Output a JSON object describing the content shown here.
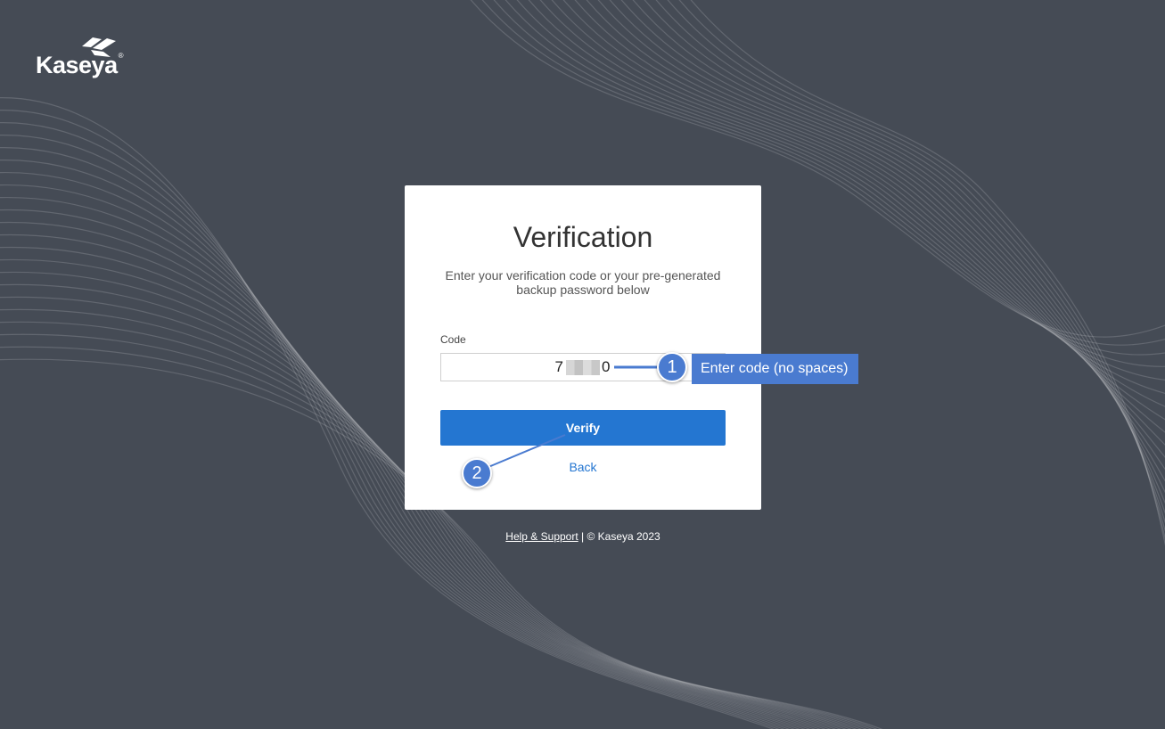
{
  "brand": {
    "name": "Kaseya",
    "registered_mark": "®"
  },
  "card": {
    "title": "Verification",
    "subtitle": "Enter your verification code or your pre-generated backup password below",
    "code_label": "Code",
    "code_value_start": "7",
    "code_value_end": "0",
    "verify_label": "Verify",
    "back_label": "Back"
  },
  "footer": {
    "help_link": "Help & Support",
    "copyright": " | © Kaseya 2023"
  },
  "annotations": {
    "step1_number": "1",
    "step1_text": "Enter code (no spaces)",
    "step2_number": "2"
  },
  "colors": {
    "background": "#454b55",
    "primary_button": "#2476d1",
    "link": "#2476d1",
    "callout": "#4a7bd0"
  }
}
